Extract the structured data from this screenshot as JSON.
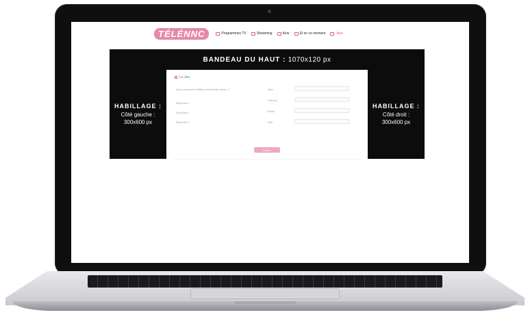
{
  "site": {
    "logo_left": "TÉLÉ",
    "logo_right": "NNC"
  },
  "nav": {
    "items": [
      {
        "label": "Programmes TV",
        "accent": false
      },
      {
        "label": "Streaming",
        "accent": false
      },
      {
        "label": "Actu",
        "accent": false
      },
      {
        "label": "Et en ce moment",
        "accent": false
      },
      {
        "label": "Jeux",
        "accent": true
      }
    ]
  },
  "ads": {
    "banner": {
      "title": "BANDEAU DU HAUT :",
      "size": "1070x120 px"
    },
    "left": {
      "title": "HABILLAGE :",
      "side": "Côté gauche :",
      "size": "300x600 px"
    },
    "right": {
      "title": "HABILLAGE :",
      "side": "Côté droit :",
      "size": "300x600 px"
    }
  },
  "form": {
    "section_title": "Le Jeu",
    "question": "Qui a remporté l'édition précédente du jeu ?",
    "options": [
      "Réponse 1",
      "Réponse 2",
      "Réponse 3"
    ],
    "fields": [
      "Nom",
      "Prénom",
      "Email",
      "Ville"
    ],
    "submit_label": "Valider"
  },
  "colors": {
    "accent": "#d75b85",
    "logo_bg": "#e58aa7",
    "ad_bg": "#0c0c0c"
  }
}
